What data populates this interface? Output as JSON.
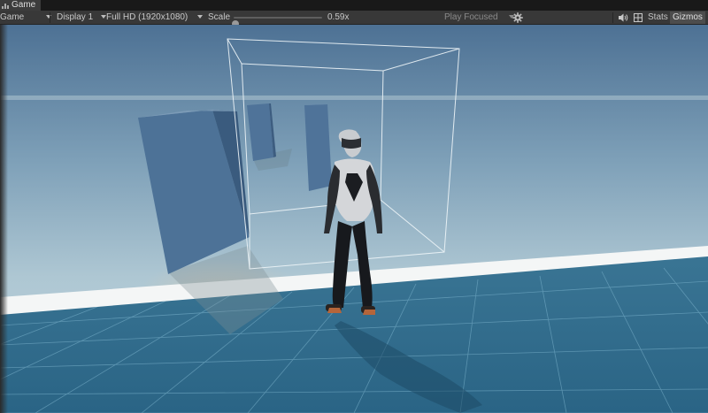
{
  "tab": {
    "label": "Game",
    "icon": "game-tab-icon"
  },
  "toolbar": {
    "view_label": "Game",
    "display_label": "Display 1",
    "resolution_label": "Full HD (1920x1080)",
    "scale_label": "Scale",
    "scale_value": "0.59x",
    "scale_fraction": 0.02,
    "play_mode_label": "Play Focused",
    "stats_label": "Stats",
    "gizmos_label": "Gizmos",
    "icons": {
      "settings": "gear-icon",
      "audio": "speaker-icon",
      "dropdowns": "caret-down-icon"
    }
  },
  "scene": {
    "colors": {
      "sky_top": "#4e7396",
      "sky_horizon": "#b5cbd6",
      "ground": "#2e6688",
      "edge_stripe": "#ffffff",
      "block_front": "#4f7399",
      "block_side": "#3a5a7c",
      "trigger_outline": "#e8f2f6"
    }
  }
}
